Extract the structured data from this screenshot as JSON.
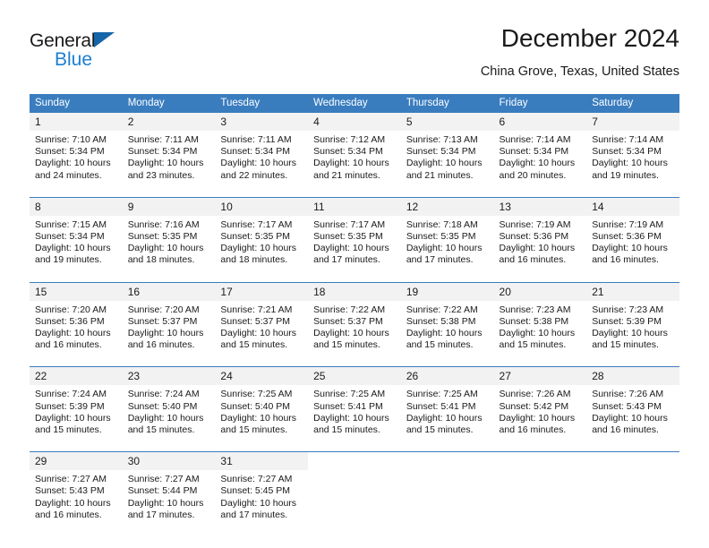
{
  "brand": {
    "name_part1": "General",
    "name_part2": "Blue",
    "triangle_icon": "blue-triangle-icon"
  },
  "header": {
    "title": "December 2024",
    "subtitle": "China Grove, Texas, United States"
  },
  "colors": {
    "header_blue": "#3a7dbf",
    "daynum_gray": "#f2f2f2",
    "logo_blue": "#1b7fd1",
    "text": "#1a1a1a"
  },
  "labels": {
    "sunrise": "Sunrise:",
    "sunset": "Sunset:",
    "daylight": "Daylight:"
  },
  "weekdays": [
    "Sunday",
    "Monday",
    "Tuesday",
    "Wednesday",
    "Thursday",
    "Friday",
    "Saturday"
  ],
  "weeks": [
    [
      {
        "day": "1",
        "sunrise": "Sunrise: 7:10 AM",
        "sunset": "Sunset: 5:34 PM",
        "daylight": "Daylight: 10 hours and 24 minutes."
      },
      {
        "day": "2",
        "sunrise": "Sunrise: 7:11 AM",
        "sunset": "Sunset: 5:34 PM",
        "daylight": "Daylight: 10 hours and 23 minutes."
      },
      {
        "day": "3",
        "sunrise": "Sunrise: 7:11 AM",
        "sunset": "Sunset: 5:34 PM",
        "daylight": "Daylight: 10 hours and 22 minutes."
      },
      {
        "day": "4",
        "sunrise": "Sunrise: 7:12 AM",
        "sunset": "Sunset: 5:34 PM",
        "daylight": "Daylight: 10 hours and 21 minutes."
      },
      {
        "day": "5",
        "sunrise": "Sunrise: 7:13 AM",
        "sunset": "Sunset: 5:34 PM",
        "daylight": "Daylight: 10 hours and 21 minutes."
      },
      {
        "day": "6",
        "sunrise": "Sunrise: 7:14 AM",
        "sunset": "Sunset: 5:34 PM",
        "daylight": "Daylight: 10 hours and 20 minutes."
      },
      {
        "day": "7",
        "sunrise": "Sunrise: 7:14 AM",
        "sunset": "Sunset: 5:34 PM",
        "daylight": "Daylight: 10 hours and 19 minutes."
      }
    ],
    [
      {
        "day": "8",
        "sunrise": "Sunrise: 7:15 AM",
        "sunset": "Sunset: 5:34 PM",
        "daylight": "Daylight: 10 hours and 19 minutes."
      },
      {
        "day": "9",
        "sunrise": "Sunrise: 7:16 AM",
        "sunset": "Sunset: 5:35 PM",
        "daylight": "Daylight: 10 hours and 18 minutes."
      },
      {
        "day": "10",
        "sunrise": "Sunrise: 7:17 AM",
        "sunset": "Sunset: 5:35 PM",
        "daylight": "Daylight: 10 hours and 18 minutes."
      },
      {
        "day": "11",
        "sunrise": "Sunrise: 7:17 AM",
        "sunset": "Sunset: 5:35 PM",
        "daylight": "Daylight: 10 hours and 17 minutes."
      },
      {
        "day": "12",
        "sunrise": "Sunrise: 7:18 AM",
        "sunset": "Sunset: 5:35 PM",
        "daylight": "Daylight: 10 hours and 17 minutes."
      },
      {
        "day": "13",
        "sunrise": "Sunrise: 7:19 AM",
        "sunset": "Sunset: 5:36 PM",
        "daylight": "Daylight: 10 hours and 16 minutes."
      },
      {
        "day": "14",
        "sunrise": "Sunrise: 7:19 AM",
        "sunset": "Sunset: 5:36 PM",
        "daylight": "Daylight: 10 hours and 16 minutes."
      }
    ],
    [
      {
        "day": "15",
        "sunrise": "Sunrise: 7:20 AM",
        "sunset": "Sunset: 5:36 PM",
        "daylight": "Daylight: 10 hours and 16 minutes."
      },
      {
        "day": "16",
        "sunrise": "Sunrise: 7:20 AM",
        "sunset": "Sunset: 5:37 PM",
        "daylight": "Daylight: 10 hours and 16 minutes."
      },
      {
        "day": "17",
        "sunrise": "Sunrise: 7:21 AM",
        "sunset": "Sunset: 5:37 PM",
        "daylight": "Daylight: 10 hours and 15 minutes."
      },
      {
        "day": "18",
        "sunrise": "Sunrise: 7:22 AM",
        "sunset": "Sunset: 5:37 PM",
        "daylight": "Daylight: 10 hours and 15 minutes."
      },
      {
        "day": "19",
        "sunrise": "Sunrise: 7:22 AM",
        "sunset": "Sunset: 5:38 PM",
        "daylight": "Daylight: 10 hours and 15 minutes."
      },
      {
        "day": "20",
        "sunrise": "Sunrise: 7:23 AM",
        "sunset": "Sunset: 5:38 PM",
        "daylight": "Daylight: 10 hours and 15 minutes."
      },
      {
        "day": "21",
        "sunrise": "Sunrise: 7:23 AM",
        "sunset": "Sunset: 5:39 PM",
        "daylight": "Daylight: 10 hours and 15 minutes."
      }
    ],
    [
      {
        "day": "22",
        "sunrise": "Sunrise: 7:24 AM",
        "sunset": "Sunset: 5:39 PM",
        "daylight": "Daylight: 10 hours and 15 minutes."
      },
      {
        "day": "23",
        "sunrise": "Sunrise: 7:24 AM",
        "sunset": "Sunset: 5:40 PM",
        "daylight": "Daylight: 10 hours and 15 minutes."
      },
      {
        "day": "24",
        "sunrise": "Sunrise: 7:25 AM",
        "sunset": "Sunset: 5:40 PM",
        "daylight": "Daylight: 10 hours and 15 minutes."
      },
      {
        "day": "25",
        "sunrise": "Sunrise: 7:25 AM",
        "sunset": "Sunset: 5:41 PM",
        "daylight": "Daylight: 10 hours and 15 minutes."
      },
      {
        "day": "26",
        "sunrise": "Sunrise: 7:25 AM",
        "sunset": "Sunset: 5:41 PM",
        "daylight": "Daylight: 10 hours and 15 minutes."
      },
      {
        "day": "27",
        "sunrise": "Sunrise: 7:26 AM",
        "sunset": "Sunset: 5:42 PM",
        "daylight": "Daylight: 10 hours and 16 minutes."
      },
      {
        "day": "28",
        "sunrise": "Sunrise: 7:26 AM",
        "sunset": "Sunset: 5:43 PM",
        "daylight": "Daylight: 10 hours and 16 minutes."
      }
    ],
    [
      {
        "day": "29",
        "sunrise": "Sunrise: 7:27 AM",
        "sunset": "Sunset: 5:43 PM",
        "daylight": "Daylight: 10 hours and 16 minutes."
      },
      {
        "day": "30",
        "sunrise": "Sunrise: 7:27 AM",
        "sunset": "Sunset: 5:44 PM",
        "daylight": "Daylight: 10 hours and 17 minutes."
      },
      {
        "day": "31",
        "sunrise": "Sunrise: 7:27 AM",
        "sunset": "Sunset: 5:45 PM",
        "daylight": "Daylight: 10 hours and 17 minutes."
      },
      {
        "day": "",
        "sunrise": "",
        "sunset": "",
        "daylight": ""
      },
      {
        "day": "",
        "sunrise": "",
        "sunset": "",
        "daylight": ""
      },
      {
        "day": "",
        "sunrise": "",
        "sunset": "",
        "daylight": ""
      },
      {
        "day": "",
        "sunrise": "",
        "sunset": "",
        "daylight": ""
      }
    ]
  ]
}
